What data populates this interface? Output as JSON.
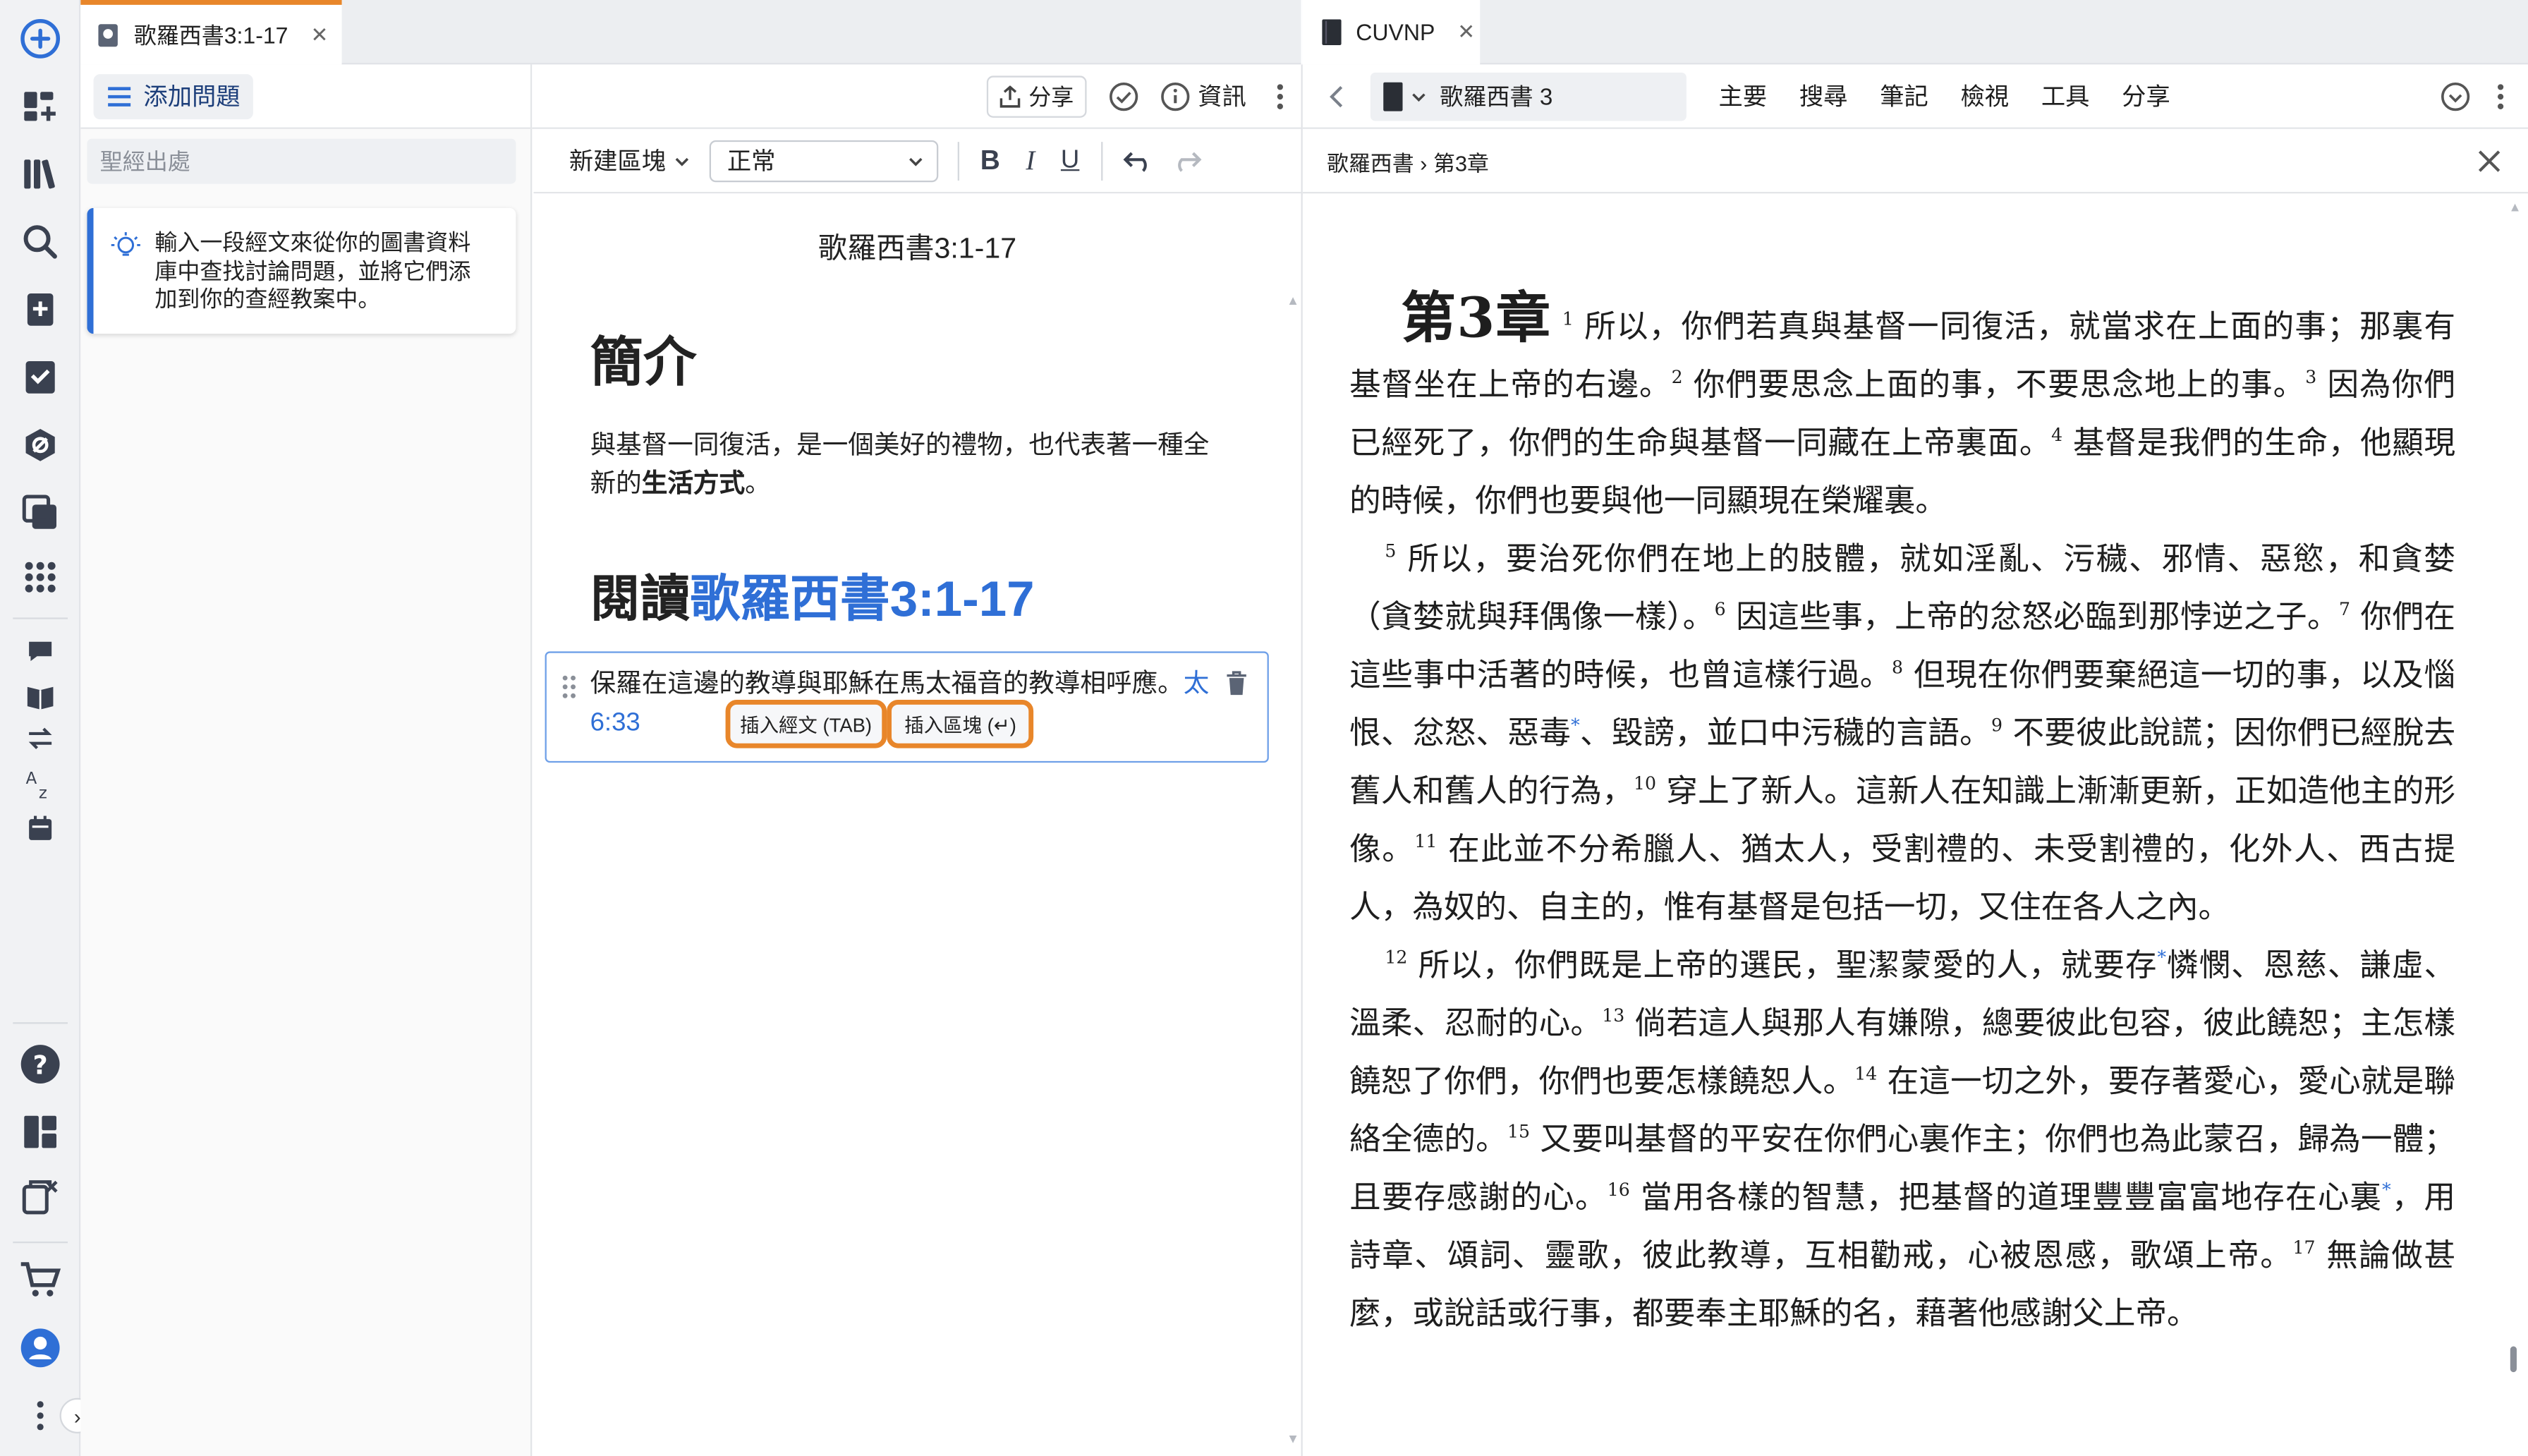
{
  "left_pane": {
    "tab_title": "歌羅西書3:1-17",
    "add_question_label": "添加問題",
    "share_label": "分享",
    "info_label": "資訊",
    "search_placeholder": "聖經出處",
    "tip_text": "輸入一段經文來從你的圖書資料庫中查找討論問題，並將它們添加到你的查經教案中。"
  },
  "editor": {
    "new_block_label": "新建區塊",
    "style_select": "正常",
    "doc_title": "歌羅西書3:1-17",
    "heading_intro": "簡介",
    "intro_text_1": "與基督一同復活，是一個美好的禮物，也代表著一種全新的",
    "intro_text_bold": "生活方式",
    "intro_text_2": "。",
    "reading_prefix": "閱讀",
    "reading_ref": "歌羅西書3:1-17",
    "block_text": "保羅在這邊的教導與耶穌在馬太福音的教導相呼應。",
    "block_ref": "太6:33",
    "insert_verse_btn": "插入經文 (TAB)",
    "insert_block_btn": "插入區塊 (↵)"
  },
  "bible": {
    "tab_title": "CUVNP",
    "book_selector": "歌羅西書 3",
    "menu": [
      "主要",
      "搜尋",
      "筆記",
      "檢視",
      "工具",
      "分享"
    ],
    "breadcrumb": "歌羅西書 › 第3章",
    "chapter_label_1": "第",
    "chapter_label_num": "3",
    "chapter_label_2": "章",
    "p1": {
      "v1": "所以，你們若真與基督一同復活，就當求在上面的事；那裏有基督坐在上帝的右邊。",
      "v2": "你們要思念上面的事，不要思念地上的事。",
      "v3": "因為你們已經死了，你們的生命與基督一同藏在上帝裏面。",
      "v4": "基督是我們的生命，他顯現的時候，你們也要與他一同顯現在榮耀裏。"
    },
    "p2": {
      "v5": "所以，要治死你們在地上的肢體，就如淫亂、污穢、邪情、惡慾，和貪婪（貪婪就與拜偶像一樣）。",
      "v6": "因這些事，上帝的忿怒必臨到那悖逆之子。",
      "v7": "你們在這些事中活著的時候，也曾這樣行過。",
      "v8a": "但現在你們要棄絕這一切的事，以及惱恨、忿怒、惡毒",
      "v8b": "、毀謗，並口中污穢的言語。",
      "v9": "不要彼此說謊；因你們已經脫去舊人和舊人的行為，",
      "v10": "穿上了新人。這新人在知識上漸漸更新，正如造他主的形像。",
      "v11": "在此並不分希臘人、猶太人，受割禮的、未受割禮的，化外人、西古提人，為奴的、自主的，惟有基督是包括一切，又住在各人之內。"
    },
    "p3": {
      "v12a": "所以，你們既是上帝的選民，聖潔蒙愛的人，就要存",
      "v12b": "憐憫、恩慈、謙虛、溫柔、忍耐的心。",
      "v13": "倘若這人與那人有嫌隙，總要彼此包容，彼此饒恕；主怎樣饒恕了你們，你們也要怎樣饒恕人。",
      "v14": "在這一切之外，要存著愛心，愛心就是聯絡全德的。",
      "v15": "又要叫基督的平安在你們心裏作主；你們也為此蒙召，歸為一體；且要存感謝的心。",
      "v16a": "當用各樣的智慧，把基督的道理豐豐富富地存在心裏",
      "v16b": "，用詩章、頌詞、靈歌，彼此教導，互相勸戒，心被恩感，歌頌上帝。",
      "v17": "無論做甚麼，或說話或行事，都要奉主耶穌的名，藉著他感謝父上帝。"
    },
    "verse_numbers": [
      "1",
      "2",
      "3",
      "4",
      "5",
      "6",
      "7",
      "8",
      "9",
      "10",
      "11",
      "12",
      "13",
      "14",
      "15",
      "16",
      "17"
    ],
    "footnote_marker": "*"
  },
  "colors": {
    "accent_blue": "#2f6fd6",
    "highlight_orange": "#e8862a",
    "rail_bg": "#f1f2f4"
  }
}
